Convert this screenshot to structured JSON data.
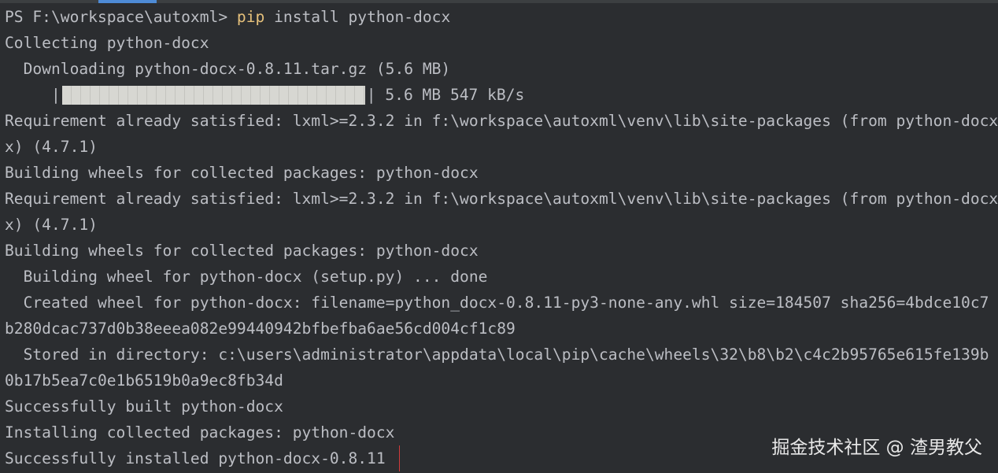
{
  "terminal": {
    "prompt": "PS F:\\workspace\\autoxml> ",
    "command_keyword": "pip",
    "command_args": " install python-docx",
    "colors": {
      "background": "#2b2d30",
      "text": "#bcbec4",
      "command": "#e5c07b",
      "highlight_box": "#d13b3b",
      "progress_fill": "#d7d7d2"
    },
    "lines": {
      "collecting": "Collecting python-docx",
      "downloading": "  Downloading python-docx-0.8.11.tar.gz (5.6 MB)",
      "progress_prefix": "     |",
      "progress_suffix": "| 5.6 MB 547 kB/s",
      "progress_fraction": 1.0,
      "req1a": "Requirement already satisfied: lxml>=2.3.2 in f:\\workspace\\autoxml\\venv\\lib\\site-packages (from python-docx",
      "req1b": "x) (4.7.1)",
      "building1": "Building wheels for collected packages: python-docx",
      "req2a": "Requirement already satisfied: lxml>=2.3.2 in f:\\workspace\\autoxml\\venv\\lib\\site-packages (from python-docx",
      "req2b": "x) (4.7.1)",
      "building2": "Building wheels for collected packages: python-docx",
      "building_wheel": "  Building wheel for python-docx (setup.py) ... done",
      "created_wheel_a": "  Created wheel for python-docx: filename=python_docx-0.8.11-py3-none-any.whl size=184507 sha256=4bdce10c7",
      "created_wheel_b": "b280dcac737d0b38eeea082e99440942bfbefba6ae56cd004cf1c89",
      "stored_a": "  Stored in directory: c:\\users\\administrator\\appdata\\local\\pip\\cache\\wheels\\32\\b8\\b2\\c4c2b95765e615fe139b",
      "stored_b": "0b17b5ea7c0e1b6519b0a9ec8fb34d",
      "built": "Successfully built python-docx",
      "installing": "Installing collected packages: python-docx",
      "installed": "Successfully installed python-docx-0.8.11"
    }
  },
  "watermark": "掘金技术社区 @ 渣男教父"
}
